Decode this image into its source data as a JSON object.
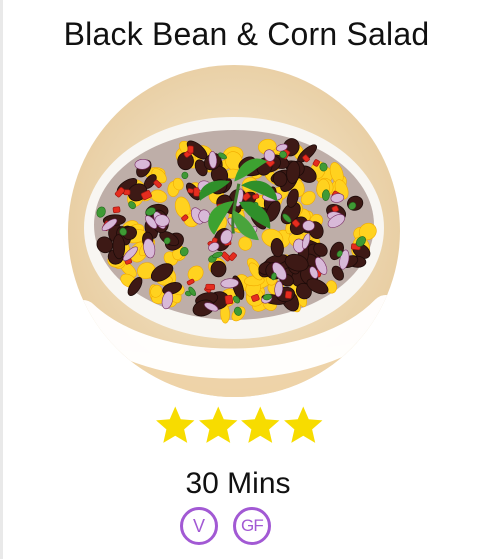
{
  "recipe": {
    "title": "Black Bean & Corn Salad",
    "rating": {
      "value": 4,
      "max": 4
    },
    "time": "30 Mins",
    "badges": [
      {
        "label": "V"
      },
      {
        "label": "GF"
      }
    ],
    "colors": {
      "star": "#f7dc00",
      "badge": "#a259d4",
      "title": "#111111"
    }
  }
}
